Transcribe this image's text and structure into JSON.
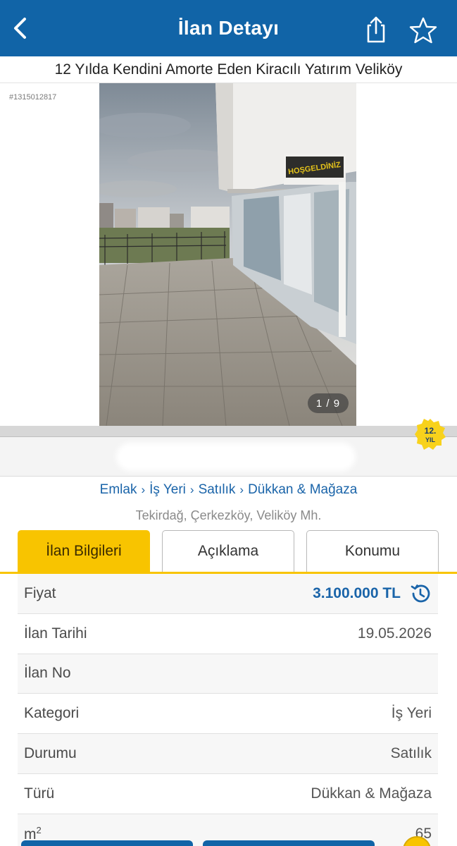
{
  "header": {
    "title": "İlan Detayı",
    "back_icon": "chevron-left-icon",
    "share_icon": "share-icon",
    "favorite_icon": "star-outline-icon"
  },
  "listing": {
    "title": "12 Yılda Kendini Amorte Eden Kiracılı Yatırım Veliköy",
    "id": "#1315012817",
    "photo_counter": "1 / 9",
    "store_sign": "HOŞGELDİNİZ"
  },
  "seller": {
    "badge_line1": "12.",
    "badge_line2": "YIL"
  },
  "breadcrumb": {
    "items": [
      "Emlak",
      "İş Yeri",
      "Satılık",
      "Dükkan & Mağaza"
    ],
    "separator": "›"
  },
  "location": "Tekirdağ, Çerkezköy, Veliköy Mh.",
  "tabs": [
    {
      "label": "İlan Bilgileri",
      "active": true
    },
    {
      "label": "Açıklama",
      "active": false
    },
    {
      "label": "Konumu",
      "active": false
    }
  ],
  "info": {
    "price_label": "Fiyat",
    "price_value": "3.100.000 TL",
    "date_label": "İlan Tarihi",
    "date_value": "19.05.2026",
    "no_label": "İlan No",
    "no_value": "",
    "category_label": "Kategori",
    "category_value": "İş Yeri",
    "status_label": "Durumu",
    "status_value": "Satılık",
    "type_label": "Türü",
    "type_value": "Dükkan & Mağaza",
    "area_label": "m",
    "area_sup": "2",
    "area_value": "65"
  },
  "colors": {
    "primary": "#1164a7",
    "accent": "#f8c400",
    "link": "#1a64a9"
  }
}
